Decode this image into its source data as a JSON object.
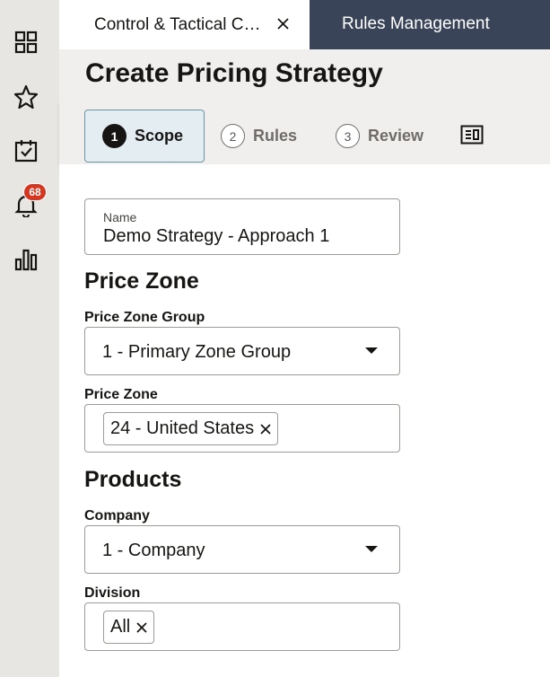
{
  "rail": {
    "items": [
      {
        "name": "dashboard-icon"
      },
      {
        "name": "star-icon"
      },
      {
        "name": "calendar-check-icon"
      },
      {
        "name": "bell-icon"
      },
      {
        "name": "bar-chart-icon"
      }
    ],
    "notification_count": "68"
  },
  "tabs": [
    {
      "label": "Control & Tactical C…",
      "active": true
    },
    {
      "label": "Rules Management",
      "active": false
    }
  ],
  "header": {
    "title": "Create Pricing Strategy"
  },
  "steps": [
    {
      "num": "1",
      "label": "Scope",
      "active": true
    },
    {
      "num": "2",
      "label": "Rules",
      "active": false
    },
    {
      "num": "3",
      "label": "Review",
      "active": false
    }
  ],
  "form": {
    "name_label": "Name",
    "name_value": "Demo Strategy - Approach 1",
    "price_zone_section": "Price Zone",
    "price_zone_group_label": "Price Zone Group",
    "price_zone_group_value": "1 - Primary Zone Group",
    "price_zone_label": "Price Zone",
    "price_zone_chip": "24 - United States",
    "products_section": "Products",
    "company_label": "Company",
    "company_value": "1 - Company",
    "division_label": "Division",
    "division_chip": "All"
  },
  "colors": {
    "rail_bg": "#e8e6e3",
    "inactive_tab_bg": "#3a4459",
    "header_bg": "#f1efed",
    "active_step_bg": "#e4edf2",
    "badge": "#d6351f"
  }
}
